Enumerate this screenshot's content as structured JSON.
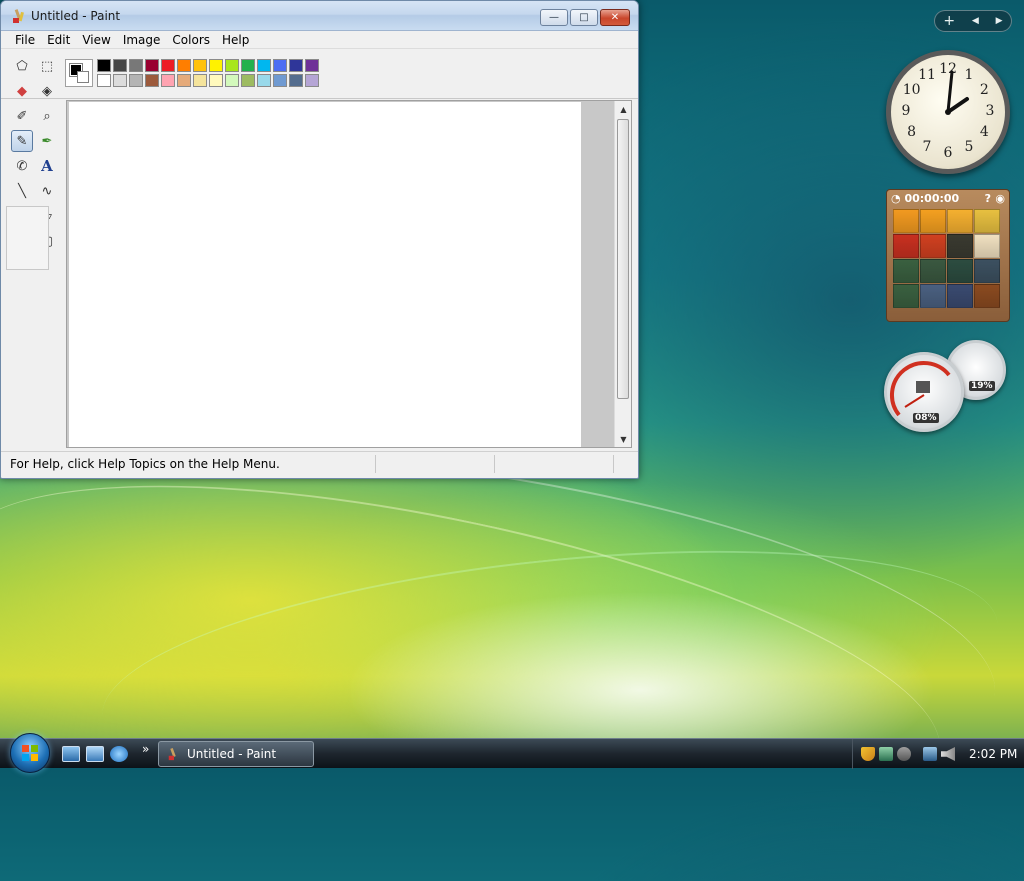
{
  "window": {
    "title": "Untitled - Paint",
    "minimize_glyph": "—",
    "maximize_glyph": "□",
    "close_glyph": "✕"
  },
  "menu": [
    "File",
    "Edit",
    "View",
    "Image",
    "Colors",
    "Help"
  ],
  "colors": {
    "foreground": "#000000",
    "background": "#ffffff",
    "palette_top": [
      "#000000",
      "#464646",
      "#787878",
      "#990030",
      "#ed1c24",
      "#ff7e00",
      "#ffc20e",
      "#fff200",
      "#a8e61d",
      "#22b14c",
      "#00b7ef",
      "#4d6df3",
      "#2f3699",
      "#6f3198"
    ],
    "palette_bottom": [
      "#ffffff",
      "#dcdcdc",
      "#b4b4b4",
      "#9c5a3c",
      "#ffa3b1",
      "#e5aa7a",
      "#f5e49c",
      "#fff9bd",
      "#d3f9bc",
      "#9dbb61",
      "#99d9ea",
      "#709ad1",
      "#546d8e",
      "#b5a5d5"
    ]
  },
  "tools": [
    {
      "name": "free-form-select-tool",
      "glyph": "⬠"
    },
    {
      "name": "select-tool",
      "glyph": "⬚"
    },
    {
      "name": "eraser-tool",
      "glyph": "◆"
    },
    {
      "name": "fill-tool",
      "glyph": "◈"
    },
    {
      "name": "color-picker-tool",
      "glyph": "✐"
    },
    {
      "name": "magnifier-tool",
      "glyph": "⌕"
    },
    {
      "name": "pencil-tool",
      "glyph": "✎"
    },
    {
      "name": "brush-tool",
      "glyph": "✒"
    },
    {
      "name": "airbrush-tool",
      "glyph": "✆"
    },
    {
      "name": "text-tool",
      "glyph": "A"
    },
    {
      "name": "line-tool",
      "glyph": "╲"
    },
    {
      "name": "curve-tool",
      "glyph": "∿"
    },
    {
      "name": "rectangle-tool",
      "glyph": "▭"
    },
    {
      "name": "polygon-tool",
      "glyph": "▱"
    },
    {
      "name": "ellipse-tool",
      "glyph": "⬭"
    },
    {
      "name": "rounded-rectangle-tool",
      "glyph": "▢"
    }
  ],
  "selected_tool": "pencil-tool",
  "status": {
    "help_text": "For Help, click Help Topics on the Help Menu."
  },
  "gadgets": {
    "add_glyph": "+",
    "prev_glyph": "◀",
    "next_glyph": "▶",
    "clock_numbers": [
      "12",
      "1",
      "2",
      "3",
      "4",
      "5",
      "6",
      "7",
      "8",
      "9",
      "10",
      "11"
    ],
    "puzzle_timer": "00:00:00",
    "cpu_meter": "08%",
    "memory_meter": "19%"
  },
  "taskbar": {
    "task_title": "Untitled - Paint",
    "chevron": "»",
    "time": "2:02 PM"
  }
}
